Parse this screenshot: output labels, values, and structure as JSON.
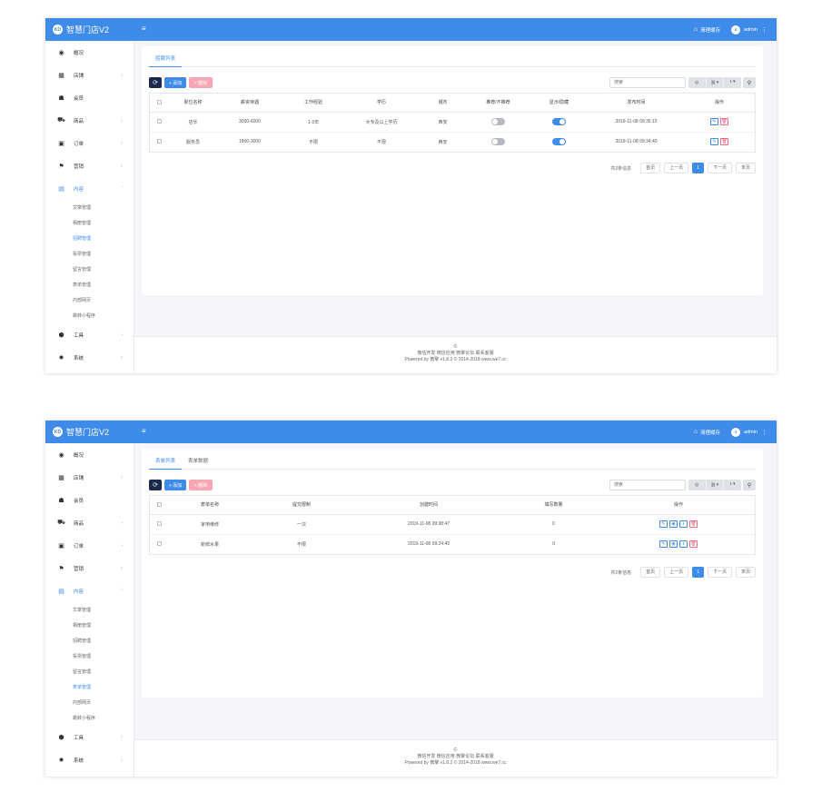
{
  "common": {
    "brand_logo": "KD",
    "brand_name": "智慧门店V2",
    "hamburger": "≡",
    "cache_label": "清理缓存",
    "avatar_text": "a",
    "user_name": "admin",
    "nav": [
      {
        "label": "概况",
        "icon": "◉"
      },
      {
        "label": "店铺",
        "icon": "▦",
        "chev": "›"
      },
      {
        "label": "会员",
        "icon": "☗"
      },
      {
        "label": "商品",
        "icon": "⛟",
        "chev": "›"
      },
      {
        "label": "订单",
        "icon": "▣",
        "chev": "›"
      },
      {
        "label": "营销",
        "icon": "⚑",
        "chev": "›"
      },
      {
        "label": "内容",
        "icon": "▤",
        "chev": "ˇ"
      }
    ],
    "sub_nav": [
      "文章管理",
      "相册管理",
      "招聘管理",
      "投票管理",
      "留言管理",
      "表单管理",
      "内部网页",
      "跳转小程序"
    ],
    "nav_bottom": [
      {
        "label": "工具",
        "icon": "⬢",
        "chev": "›"
      },
      {
        "label": "系统",
        "icon": "✹",
        "chev": "›"
      }
    ],
    "toolbar": {
      "refresh_icon": "⟳",
      "add_label": "+ 添加",
      "delete_label": "× 删除",
      "search_placeholder": "搜索",
      "view_icon": "◎",
      "columns_icon": "▥ ▾",
      "export_icon": "⭳ ▾",
      "search_icon": "⚲"
    },
    "pager": {
      "total": "共2条信息",
      "first": "首页",
      "prev": "上一页",
      "current": "1",
      "next": "下一页",
      "last": "末页"
    },
    "footer": {
      "copyright_mark": "©",
      "links": "微信开发 微信应用 微擎论坛 联系客服",
      "powered": "Powered by 微擎 v1.8.2 © 2014-2018 www.we7.cc"
    },
    "actions": {
      "edit": "✎",
      "view": "◉",
      "down": "⭳",
      "del": "🗑"
    }
  },
  "screen1": {
    "active_sub": "招聘管理",
    "tabs": [
      "招聘列表"
    ],
    "columns": [
      "职位名称",
      "薪资待遇",
      "工作经验",
      "学历",
      "城市",
      "推荐/不推荐",
      "显示/隐藏",
      "发布时间",
      "操作"
    ],
    "rows": [
      {
        "name": "店长",
        "salary": "3000-6000",
        "exp": "1-2年",
        "edu": "大专及以上学历",
        "city": "西安",
        "recommend": "off",
        "show": "on",
        "time": "2019-11-08 09:35:10"
      },
      {
        "name": "服务员",
        "salary": "1800-3000",
        "exp": "不限",
        "edu": "不限",
        "city": "西安",
        "recommend": "off",
        "show": "on",
        "time": "2019-11-08 09:34:40"
      }
    ]
  },
  "screen2": {
    "active_sub": "表单管理",
    "tabs": [
      "表单列表",
      "表单数据"
    ],
    "columns": [
      "表单名称",
      "提交限制",
      "创建时间",
      "填写数量",
      "操作"
    ],
    "rows": [
      {
        "name": "家电维修",
        "limit": "一次",
        "time": "2019-11-08 09:38:47",
        "count": "0"
      },
      {
        "name": "新鲜水果",
        "limit": "不限",
        "time": "2019-11-08 09:24:42",
        "count": "0"
      }
    ]
  },
  "colors": {
    "primary": "#3f8bea",
    "danger": "#ef6a7f",
    "dark": "#1b2a4a"
  }
}
